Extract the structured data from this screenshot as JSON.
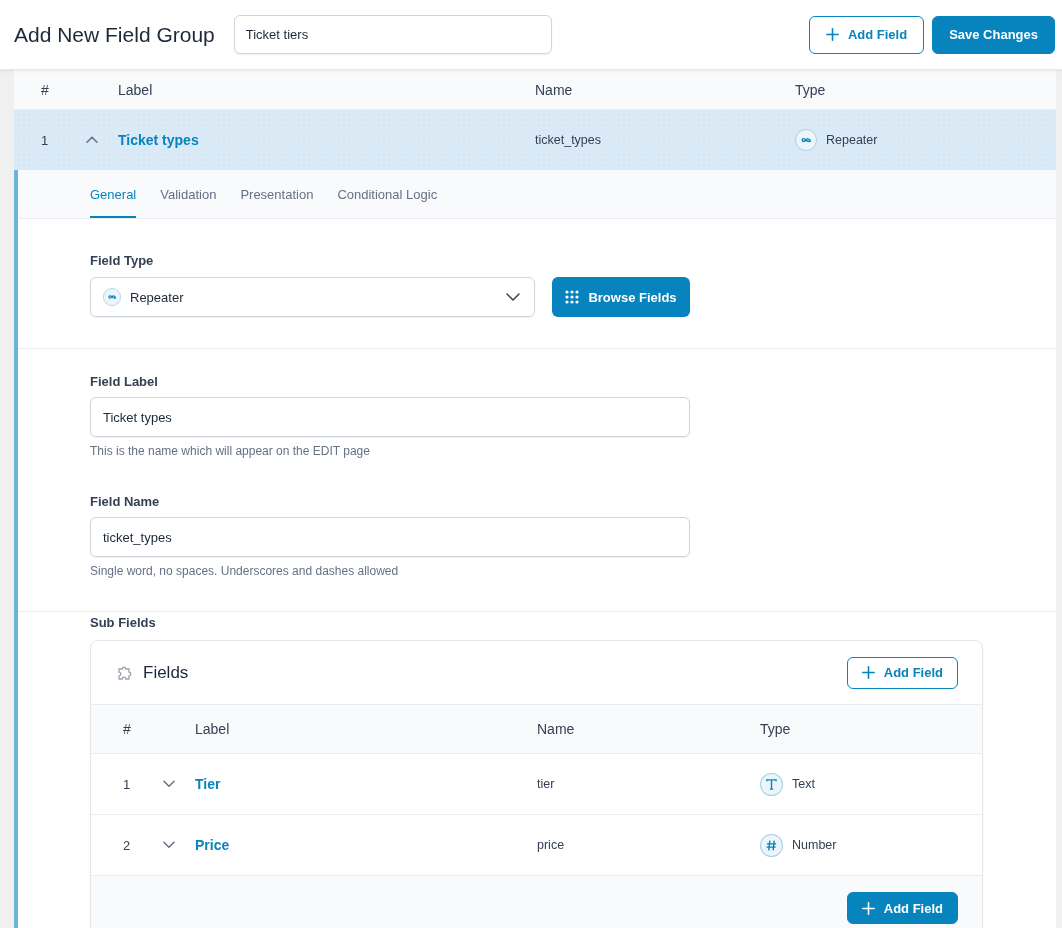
{
  "header": {
    "title": "Add New Field Group",
    "title_field": {
      "value": "Ticket tiers"
    },
    "buttons": [
      {
        "label": "Add Field",
        "kind": "add"
      },
      {
        "label": "Save Changes",
        "kind": "save"
      }
    ]
  },
  "field_list": {
    "columns": [
      "#",
      "Label",
      "Name",
      "Type"
    ],
    "rows": [
      {
        "number": "1",
        "label": "Ticket types",
        "name": "ticket_types",
        "type": "Repeater",
        "kind": "repeater",
        "expanded": true
      }
    ]
  },
  "settings": {
    "tabs": [
      {
        "label": "General",
        "selected": true
      },
      {
        "label": "Validation",
        "selected": false
      },
      {
        "label": "Presentation",
        "selected": false
      },
      {
        "label": "Conditional Logic",
        "selected": false
      }
    ],
    "field_type": {
      "label": "Field Type",
      "value": "Repeater",
      "kind": "repeater",
      "button": "Browse Fields"
    },
    "text_fields": [
      {
        "label": "Field Label",
        "value": "Ticket types",
        "help": "This is the name which will appear on the EDIT page"
      },
      {
        "label": "Field Name",
        "value": "ticket_types",
        "help": "Single word, no spaces. Underscores and dashes allowed"
      }
    ],
    "sub_fields": {
      "label": "Sub Fields",
      "title": "Fields",
      "add_button": "Add Field",
      "columns": [
        "#",
        "Label",
        "Name",
        "Type"
      ],
      "rows": [
        {
          "number": "1",
          "label": "Tier",
          "name": "tier",
          "type": "Text",
          "kind": "text",
          "expanded": false
        },
        {
          "number": "2",
          "label": "Price",
          "name": "price",
          "type": "Number",
          "kind": "number",
          "expanded": false
        }
      ],
      "footer_button": "Add Field"
    }
  }
}
